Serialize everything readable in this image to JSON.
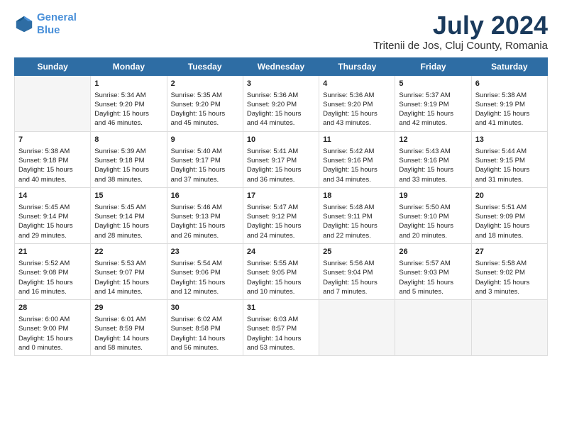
{
  "logo": {
    "line1": "General",
    "line2": "Blue"
  },
  "title": "July 2024",
  "subtitle": "Tritenii de Jos, Cluj County, Romania",
  "days_header": [
    "Sunday",
    "Monday",
    "Tuesday",
    "Wednesday",
    "Thursday",
    "Friday",
    "Saturday"
  ],
  "weeks": [
    [
      {
        "day": "",
        "info": ""
      },
      {
        "day": "1",
        "info": "Sunrise: 5:34 AM\nSunset: 9:20 PM\nDaylight: 15 hours\nand 46 minutes."
      },
      {
        "day": "2",
        "info": "Sunrise: 5:35 AM\nSunset: 9:20 PM\nDaylight: 15 hours\nand 45 minutes."
      },
      {
        "day": "3",
        "info": "Sunrise: 5:36 AM\nSunset: 9:20 PM\nDaylight: 15 hours\nand 44 minutes."
      },
      {
        "day": "4",
        "info": "Sunrise: 5:36 AM\nSunset: 9:20 PM\nDaylight: 15 hours\nand 43 minutes."
      },
      {
        "day": "5",
        "info": "Sunrise: 5:37 AM\nSunset: 9:19 PM\nDaylight: 15 hours\nand 42 minutes."
      },
      {
        "day": "6",
        "info": "Sunrise: 5:38 AM\nSunset: 9:19 PM\nDaylight: 15 hours\nand 41 minutes."
      }
    ],
    [
      {
        "day": "7",
        "info": "Sunrise: 5:38 AM\nSunset: 9:18 PM\nDaylight: 15 hours\nand 40 minutes."
      },
      {
        "day": "8",
        "info": "Sunrise: 5:39 AM\nSunset: 9:18 PM\nDaylight: 15 hours\nand 38 minutes."
      },
      {
        "day": "9",
        "info": "Sunrise: 5:40 AM\nSunset: 9:17 PM\nDaylight: 15 hours\nand 37 minutes."
      },
      {
        "day": "10",
        "info": "Sunrise: 5:41 AM\nSunset: 9:17 PM\nDaylight: 15 hours\nand 36 minutes."
      },
      {
        "day": "11",
        "info": "Sunrise: 5:42 AM\nSunset: 9:16 PM\nDaylight: 15 hours\nand 34 minutes."
      },
      {
        "day": "12",
        "info": "Sunrise: 5:43 AM\nSunset: 9:16 PM\nDaylight: 15 hours\nand 33 minutes."
      },
      {
        "day": "13",
        "info": "Sunrise: 5:44 AM\nSunset: 9:15 PM\nDaylight: 15 hours\nand 31 minutes."
      }
    ],
    [
      {
        "day": "14",
        "info": "Sunrise: 5:45 AM\nSunset: 9:14 PM\nDaylight: 15 hours\nand 29 minutes."
      },
      {
        "day": "15",
        "info": "Sunrise: 5:45 AM\nSunset: 9:14 PM\nDaylight: 15 hours\nand 28 minutes."
      },
      {
        "day": "16",
        "info": "Sunrise: 5:46 AM\nSunset: 9:13 PM\nDaylight: 15 hours\nand 26 minutes."
      },
      {
        "day": "17",
        "info": "Sunrise: 5:47 AM\nSunset: 9:12 PM\nDaylight: 15 hours\nand 24 minutes."
      },
      {
        "day": "18",
        "info": "Sunrise: 5:48 AM\nSunset: 9:11 PM\nDaylight: 15 hours\nand 22 minutes."
      },
      {
        "day": "19",
        "info": "Sunrise: 5:50 AM\nSunset: 9:10 PM\nDaylight: 15 hours\nand 20 minutes."
      },
      {
        "day": "20",
        "info": "Sunrise: 5:51 AM\nSunset: 9:09 PM\nDaylight: 15 hours\nand 18 minutes."
      }
    ],
    [
      {
        "day": "21",
        "info": "Sunrise: 5:52 AM\nSunset: 9:08 PM\nDaylight: 15 hours\nand 16 minutes."
      },
      {
        "day": "22",
        "info": "Sunrise: 5:53 AM\nSunset: 9:07 PM\nDaylight: 15 hours\nand 14 minutes."
      },
      {
        "day": "23",
        "info": "Sunrise: 5:54 AM\nSunset: 9:06 PM\nDaylight: 15 hours\nand 12 minutes."
      },
      {
        "day": "24",
        "info": "Sunrise: 5:55 AM\nSunset: 9:05 PM\nDaylight: 15 hours\nand 10 minutes."
      },
      {
        "day": "25",
        "info": "Sunrise: 5:56 AM\nSunset: 9:04 PM\nDaylight: 15 hours\nand 7 minutes."
      },
      {
        "day": "26",
        "info": "Sunrise: 5:57 AM\nSunset: 9:03 PM\nDaylight: 15 hours\nand 5 minutes."
      },
      {
        "day": "27",
        "info": "Sunrise: 5:58 AM\nSunset: 9:02 PM\nDaylight: 15 hours\nand 3 minutes."
      }
    ],
    [
      {
        "day": "28",
        "info": "Sunrise: 6:00 AM\nSunset: 9:00 PM\nDaylight: 15 hours\nand 0 minutes."
      },
      {
        "day": "29",
        "info": "Sunrise: 6:01 AM\nSunset: 8:59 PM\nDaylight: 14 hours\nand 58 minutes."
      },
      {
        "day": "30",
        "info": "Sunrise: 6:02 AM\nSunset: 8:58 PM\nDaylight: 14 hours\nand 56 minutes."
      },
      {
        "day": "31",
        "info": "Sunrise: 6:03 AM\nSunset: 8:57 PM\nDaylight: 14 hours\nand 53 minutes."
      },
      {
        "day": "",
        "info": ""
      },
      {
        "day": "",
        "info": ""
      },
      {
        "day": "",
        "info": ""
      }
    ]
  ]
}
